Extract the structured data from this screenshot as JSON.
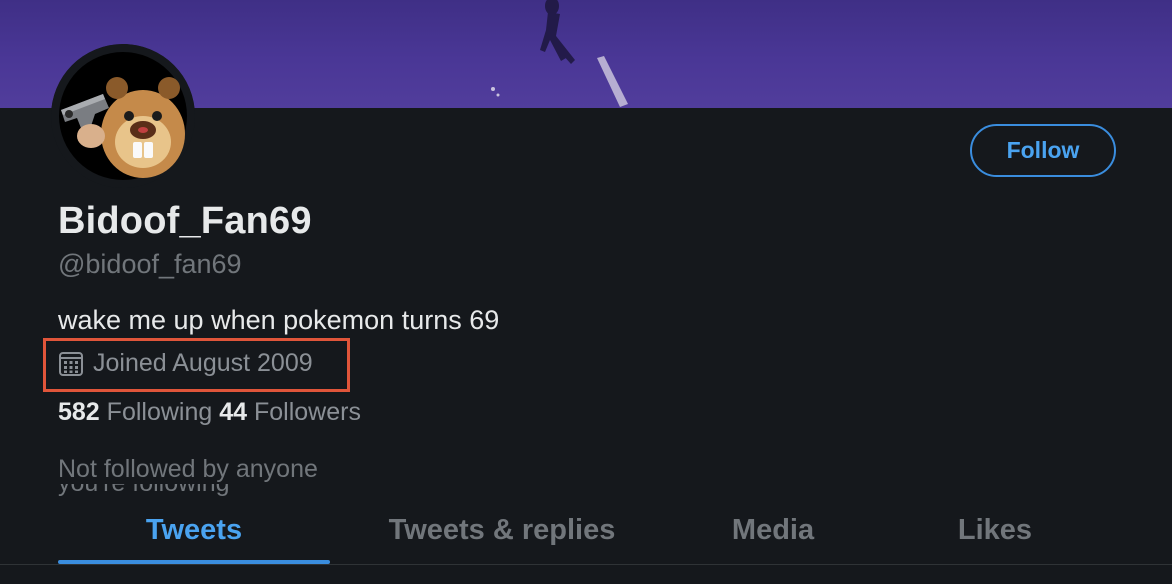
{
  "profile": {
    "display_name": "Bidoof_Fan69",
    "handle": "@bidoof_fan69",
    "bio": "wake me up when pokemon turns 69",
    "joined": "Joined August 2009",
    "following_count": "582",
    "following_label": "Following",
    "followers_count": "44",
    "followers_label": "Followers",
    "not_followed_text": "Not followed by anyone",
    "truncated_text": "you're following"
  },
  "actions": {
    "follow_label": "Follow"
  },
  "tabs": [
    {
      "label": "Tweets",
      "active": true
    },
    {
      "label": "Tweets & replies",
      "active": false
    },
    {
      "label": "Media",
      "active": false
    },
    {
      "label": "Likes",
      "active": false
    }
  ],
  "icons": {
    "joined": "calendar-icon"
  },
  "colors": {
    "accent": "#3a8dde",
    "background": "#15181c",
    "banner": "#4a3796",
    "highlight_box": "#e0553a"
  }
}
